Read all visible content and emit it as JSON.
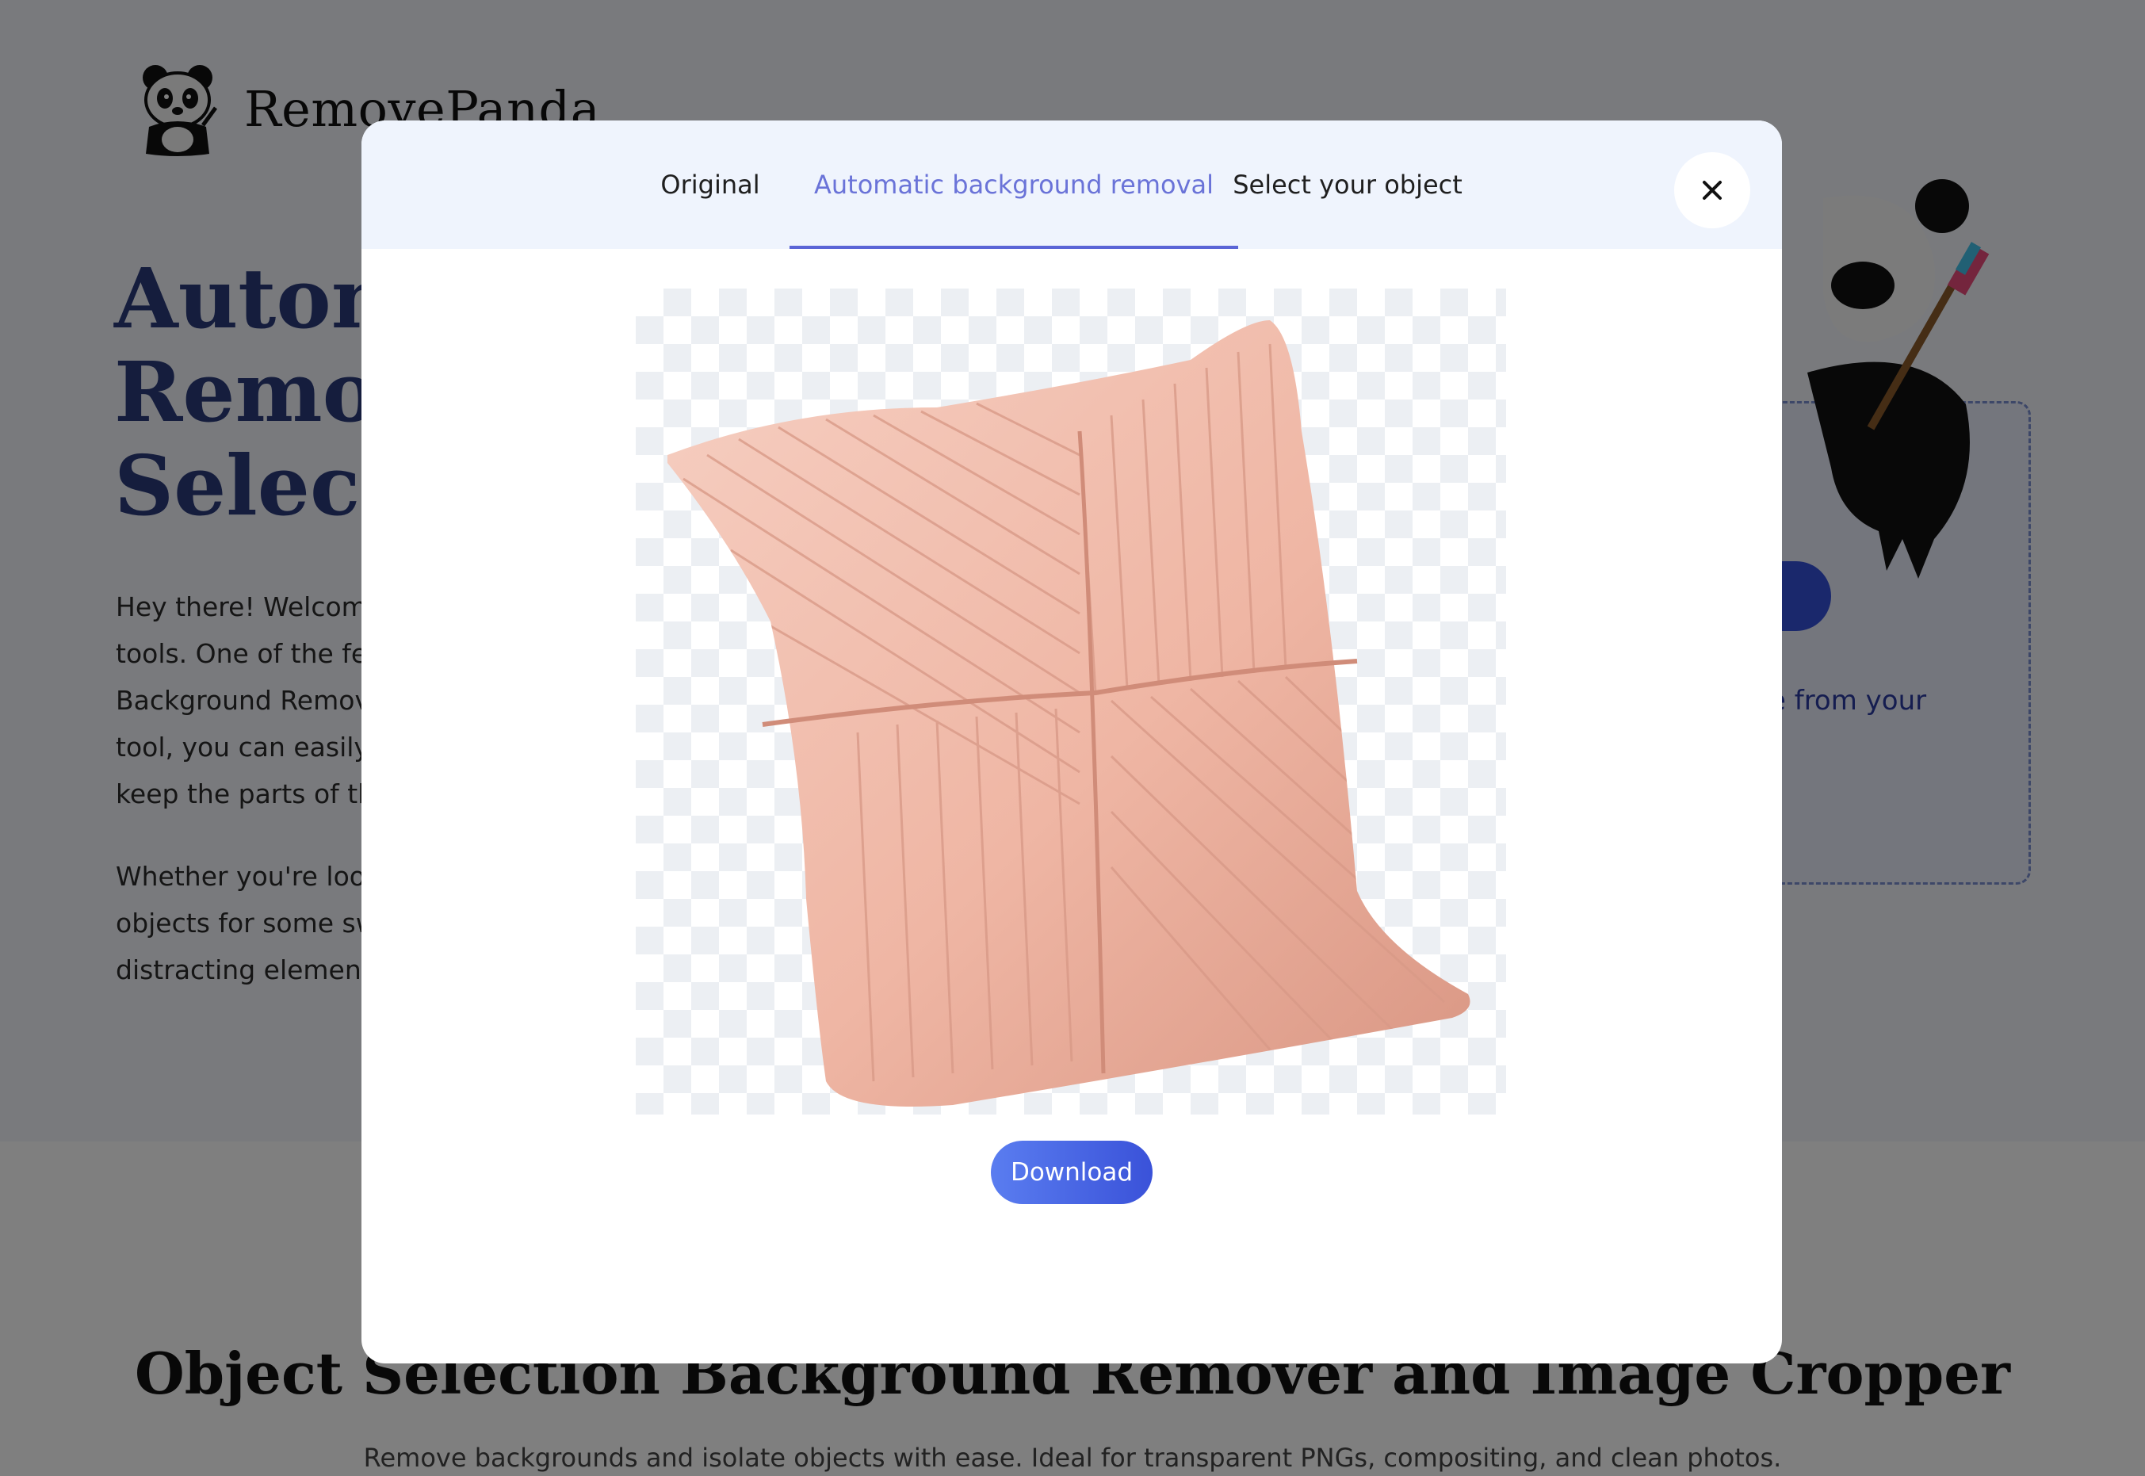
{
  "brand": {
    "name": "RemovePanda"
  },
  "hero": {
    "title_lines": [
      "Automa",
      "Remova",
      "Selectio"
    ],
    "paragraph1_lines": [
      "Hey there! Welcome",
      "tools. One of the feat",
      "Background Remova",
      "tool, you can easily g",
      "keep the parts of the"
    ],
    "paragraph2_lines": [
      "Whether you're look",
      "objects for some swe",
      "distracting elements"
    ],
    "upload_hint": "e from your"
  },
  "section": {
    "title": "Object Selection Background Remover and Image Cropper",
    "subtitle": "Remove backgrounds and isolate objects with ease. Ideal for transparent PNGs, compositing, and clean photos."
  },
  "modal": {
    "tabs": [
      {
        "label": "Original"
      },
      {
        "label": "Automatic background removal"
      },
      {
        "label": "Select your object"
      }
    ],
    "active_tab": "Automatic background removal",
    "download_label": "Download"
  },
  "colors": {
    "accent": "#6a73d8",
    "tab_underline": "#5b65d6",
    "download_start": "#5a7df0",
    "download_end": "#3a52d9",
    "hero_title": "#2b3a7a",
    "pillow": "#efb6a4"
  },
  "icons": {
    "close": "close-icon",
    "logo": "panda-logo-icon"
  }
}
